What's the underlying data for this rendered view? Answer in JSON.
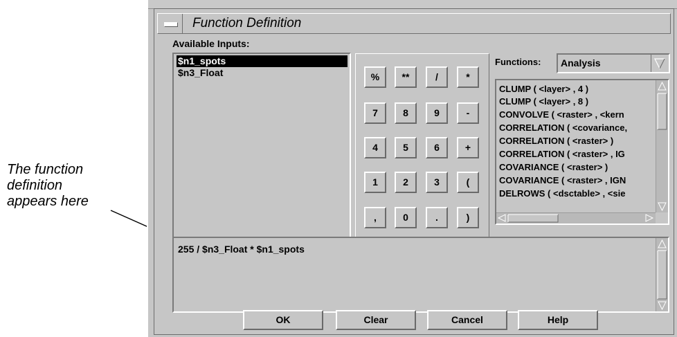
{
  "annotation": {
    "lines": [
      "The function",
      "definition",
      "appears here"
    ]
  },
  "window": {
    "title": "Function Definition"
  },
  "inputs": {
    "label": "Available Inputs:",
    "items": [
      "$n1_spots",
      "$n3_Float"
    ],
    "selected": "$n1_spots"
  },
  "keypad": {
    "keys": [
      [
        "%",
        "**",
        "/",
        "*"
      ],
      [
        "7",
        "8",
        "9",
        "-"
      ],
      [
        "4",
        "5",
        "6",
        "+"
      ],
      [
        "1",
        "2",
        "3",
        "("
      ],
      [
        ",",
        "0",
        ".",
        ")"
      ]
    ]
  },
  "functions": {
    "label": "Functions:",
    "category": "Analysis",
    "items": [
      "CLUMP ( <layer> , 4 )",
      "CLUMP ( <layer> , 8 )",
      "CONVOLVE ( <raster> , <kern",
      "CORRELATION ( <covariance,",
      "CORRELATION ( <raster> )",
      "CORRELATION ( <raster> , IG",
      "COVARIANCE ( <raster> )",
      "COVARIANCE ( <raster> , IGN",
      "DELROWS ( <dsctable> , <sie"
    ]
  },
  "editor": {
    "expression": "255 / $n3_Float * $n1_spots"
  },
  "buttons": {
    "ok": "OK",
    "clear": "Clear",
    "cancel": "Cancel",
    "help": "Help"
  },
  "colors": {
    "window_bg": "#c6c6c6",
    "selection_bg": "#000000",
    "selection_fg": "#ffffff"
  }
}
